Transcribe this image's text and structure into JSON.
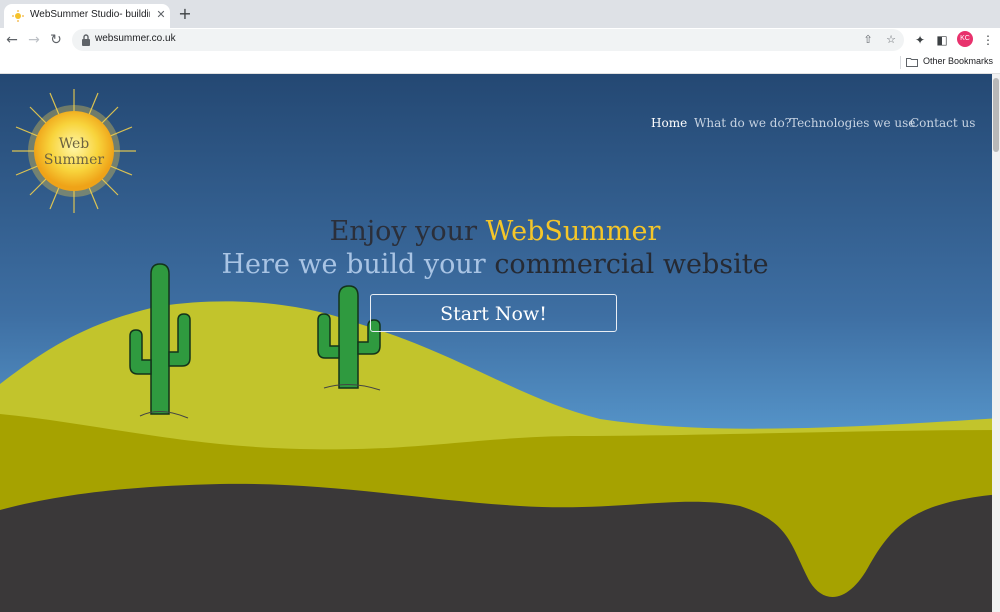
{
  "browser": {
    "tab_title": "WebSummer Studio- building c",
    "tab_close": "✕",
    "new_tab": "+",
    "url": "websummer.co.uk",
    "bookmark_folder": "Other Bookmarks",
    "avatar_initials": "KC",
    "icons": [
      "back-icon",
      "forward-icon",
      "reload-icon",
      "lock-icon",
      "share-icon",
      "star-icon",
      "extensions-icon",
      "side-panel-icon",
      "menu-icon",
      "folder-icon"
    ]
  },
  "site": {
    "logo_line1": "Web",
    "logo_line2": "Summer",
    "nav": [
      "Home",
      "What do we do?",
      "Technologies we use",
      "Contact us"
    ],
    "active_nav": "Home",
    "hero_line1_part1": "Enjoy your",
    "hero_line1_accent": "WebSummer",
    "hero_line2_part1": "Here we build your",
    "hero_line2_part2": "commercial website",
    "cta_label": "Start Now!"
  },
  "colors": {
    "sky_top": "#244873",
    "sky_bottom": "#62a6d8",
    "hill_light": "#c2c42c",
    "hill_dark": "#a6a200",
    "ground": "#3a3839",
    "cactus": "#2f9a3f",
    "accent_yellow": "#f4c629"
  }
}
